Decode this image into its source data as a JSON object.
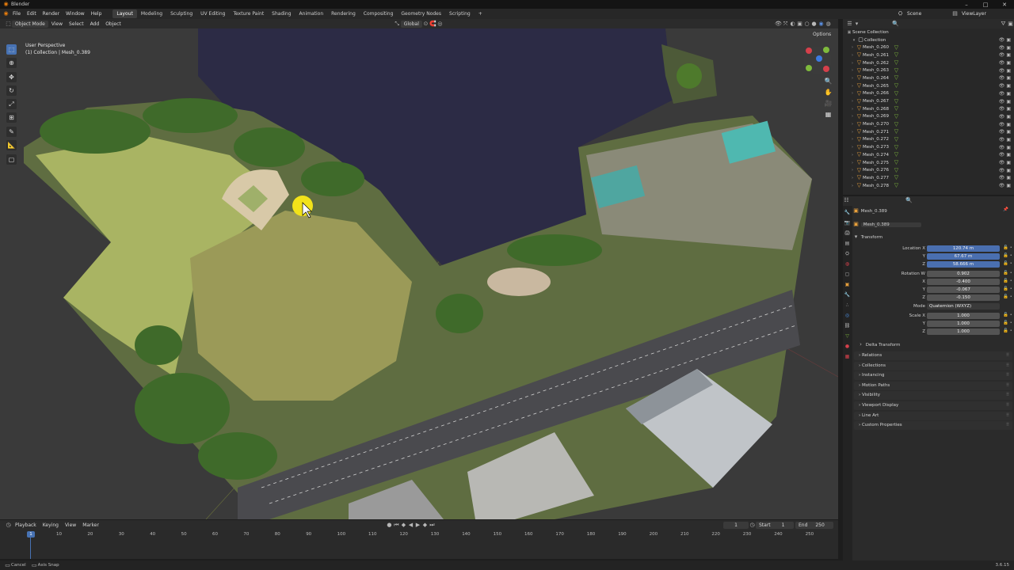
{
  "window": {
    "title": "Blender"
  },
  "menubar": {
    "menus": [
      "File",
      "Edit",
      "Render",
      "Window",
      "Help"
    ],
    "workspaces": [
      "Layout",
      "Modeling",
      "Sculpting",
      "UV Editing",
      "Texture Paint",
      "Shading",
      "Animation",
      "Rendering",
      "Compositing",
      "Geometry Nodes",
      "Scripting"
    ],
    "active_workspace": "Layout",
    "scene": "Scene",
    "view_layer": "ViewLayer"
  },
  "viewport_header": {
    "mode": "Object Mode",
    "menus": [
      "View",
      "Select",
      "Add",
      "Object"
    ],
    "transform_orientation": "Global",
    "options": "Options"
  },
  "viewport_overlay": {
    "perspective": "User Perspective",
    "collection_info": "(1) Collection | Mesh_0.389"
  },
  "outliner": {
    "root": "Scene Collection",
    "collection": "Collection",
    "items": [
      "Mesh_0.260",
      "Mesh_0.261",
      "Mesh_0.262",
      "Mesh_0.263",
      "Mesh_0.264",
      "Mesh_0.265",
      "Mesh_0.266",
      "Mesh_0.267",
      "Mesh_0.268",
      "Mesh_0.269",
      "Mesh_0.270",
      "Mesh_0.271",
      "Mesh_0.272",
      "Mesh_0.273",
      "Mesh_0.274",
      "Mesh_0.275",
      "Mesh_0.276",
      "Mesh_0.277",
      "Mesh_0.278"
    ]
  },
  "properties": {
    "object_name": "Mesh_0.389",
    "data_name": "Mesh_0.389",
    "transform_label": "Transform",
    "location_label": "Location X",
    "location": [
      "120.74 m",
      "67.67 m",
      "58.666 m"
    ],
    "rotation_label": "Rotation W",
    "rotation": [
      "0.902",
      "-0.400",
      "-0.067",
      "-0.150"
    ],
    "mode_label": "Mode",
    "mode_value": "Quaternion (WXYZ)",
    "scale_label": "Scale X",
    "scale": [
      "1.000",
      "1.000",
      "1.000"
    ],
    "axis_y": "Y",
    "axis_z": "Z",
    "axis_x": "X",
    "delta_transform": "Delta Transform",
    "panels": [
      "Relations",
      "Collections",
      "Instancing",
      "Motion Paths",
      "Visibility",
      "Viewport Display",
      "Line Art",
      "Custom Properties"
    ]
  },
  "timeline": {
    "menus": [
      "Playback",
      "Keying",
      "View",
      "Marker"
    ],
    "current_frame": "1",
    "start_label": "Start",
    "start": "1",
    "end_label": "End",
    "end": "250",
    "ticks": [
      "10",
      "20",
      "30",
      "40",
      "50",
      "60",
      "70",
      "80",
      "90",
      "100",
      "110",
      "120",
      "130",
      "140",
      "150",
      "160",
      "170",
      "180",
      "190",
      "200",
      "210",
      "220",
      "230",
      "240",
      "250"
    ],
    "playhead": "1"
  },
  "statusbar": {
    "cancel": "Cancel",
    "axis_snap": "Axis Snap",
    "version": "3.6.15"
  },
  "colors": {
    "accent": "#4772b3",
    "water": "#2c2b45",
    "grass": "#a9b463",
    "trees": "#3f6a2a",
    "cursor_highlight": "#f2e21a"
  }
}
